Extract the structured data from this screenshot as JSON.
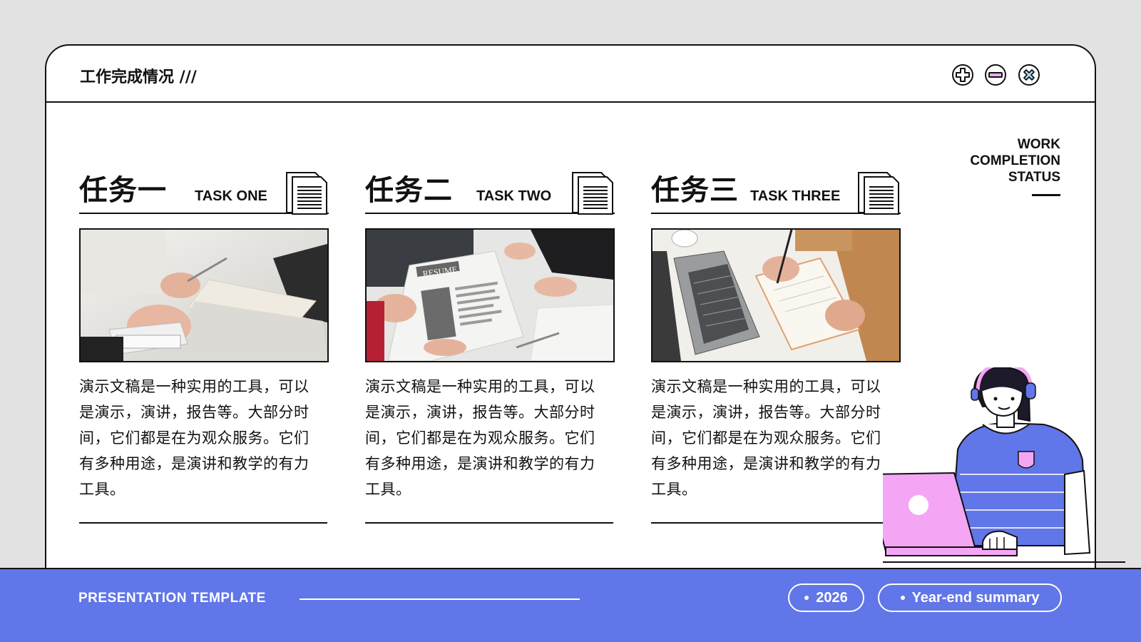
{
  "window": {
    "title": "工作完成情况 ///",
    "controls": [
      {
        "name": "plus-icon"
      },
      {
        "name": "minus-icon"
      },
      {
        "name": "close-icon"
      }
    ]
  },
  "side_heading": {
    "line1": "WORK",
    "line2": "COMPLETION",
    "line3": "STATUS"
  },
  "tasks": [
    {
      "title_cn": "任务一",
      "title_en": "TASK ONE",
      "photo": "calculator-desk-photo",
      "desc_lines": [
        "演示文稿是一种实用的工具，可以",
        "是演示，演讲，报告等。大部分时",
        "间，它们都是在为观众服务。它们",
        "有多种用途，是演讲和教学的有力",
        "工具。"
      ]
    },
    {
      "title_cn": "任务二",
      "title_en": "TASK TWO",
      "photo": "resume-interview-photo",
      "photo_text": "RESUME",
      "desc_lines": [
        "演示文稿是一种实用的工具，可以",
        "是演示，演讲，报告等。大部分时",
        "间，它们都是在为观众服务。它们",
        "有多种用途，是演讲和教学的有力",
        "工具。"
      ]
    },
    {
      "title_cn": "任务三",
      "title_en": "TASK THREE",
      "photo": "laptop-notebook-photo",
      "desc_lines": [
        "演示文稿是一种实用的工具，可以",
        "是演示，演讲，报告等。大部分时",
        "间，它们都是在为观众服务。它们",
        "有多种用途，是演讲和教学的有力",
        "工具。"
      ]
    }
  ],
  "footer": {
    "title": "PRESENTATION TEMPLATE",
    "year": "2026",
    "summary": "Year-end summary"
  },
  "colors": {
    "accent": "#6176e8",
    "pink": "#f4a6f4",
    "ink": "#111111"
  }
}
